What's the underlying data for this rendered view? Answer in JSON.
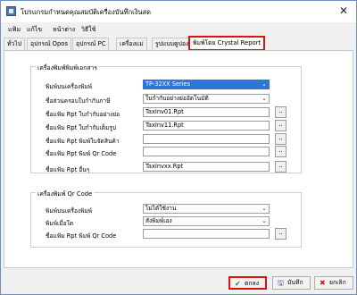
{
  "window": {
    "title": "โปรแกรมกำหนดคุณสมบัติเครื่องบันทึกเงินสด",
    "close_glyph": "✕",
    "icon": "app-icon"
  },
  "menu": [
    "แฟ้ม",
    "แก้ไข",
    "หน้าต่าง",
    "วิธีใช้"
  ],
  "tabs": [
    "ทั่วไป",
    "อุปกรณ์ Opos",
    "อุปกรณ์ PC",
    "เครื่องแม่",
    "รูปแบบคูปอง",
    "พิมพ์โดย Crystal Report"
  ],
  "active_tab": 5,
  "doc_printer_group": {
    "title": "เครื่องพิมพ์พิมพ์เอกสาร",
    "fields": [
      {
        "label": "พิมพ์บนเครื่องพิมพ์",
        "value": "TP-32XX Series",
        "kind": "select",
        "selected": true
      },
      {
        "label": "ชื่อส่วนครอบใบกำกับภาษี",
        "value": "ใบกำกับอย่างย่ออัตโนมัติ",
        "kind": "select"
      },
      {
        "label": "ชื่อแฟ้ม Rpt ใบกำกับอย่างย่อ",
        "value": "TaxInv01.Rpt",
        "kind": "file"
      },
      {
        "label": "ชื่อแฟ้ม Rpt ใบกำกับเต็มรูป",
        "value": "TaxInv11.Rpt",
        "kind": "file"
      },
      {
        "label": "ชื่อแฟ้ม Rpt พิมพ์ใบจัดสินค้า",
        "value": "",
        "kind": "file"
      },
      {
        "label": "ชื่อแฟ้ม Rpt พิมพ์ Qr Code",
        "value": "",
        "kind": "file"
      },
      {
        "label": "ชื่อแฟ้ม Rpt อื่นๆ",
        "value": "TaxInvxx.Rpt",
        "kind": "file"
      }
    ]
  },
  "qr_printer_group": {
    "title": "เครื่องพิมพ์ Qr Code",
    "fields": [
      {
        "label": "พิมพ์บนเครื่องพิมพ์",
        "value": "ไม่ได้ใช้งาน",
        "kind": "select"
      },
      {
        "label": "พิมพ์เมื่อใด",
        "value": "สั่งพิมพ์เอง",
        "kind": "select"
      },
      {
        "label": "ชื่อแฟ้ม Rpt พิมพ์ Qr Code",
        "value": "",
        "kind": "file"
      }
    ]
  },
  "browse_label": "..",
  "buttons": {
    "ok": {
      "label": "ตกลง",
      "icon": "check-icon",
      "glyph": "✔",
      "color": "#1a9a2a"
    },
    "save": {
      "label": "บันทึก",
      "icon": "save-icon",
      "glyph": "🖫",
      "color": "#1b3f8f"
    },
    "cancel": {
      "label": "ยกเลิก",
      "icon": "cancel-icon",
      "glyph": "✖",
      "color": "#d01818"
    }
  },
  "colors": {
    "highlight": "#e01010",
    "selection": "#3076d4"
  }
}
